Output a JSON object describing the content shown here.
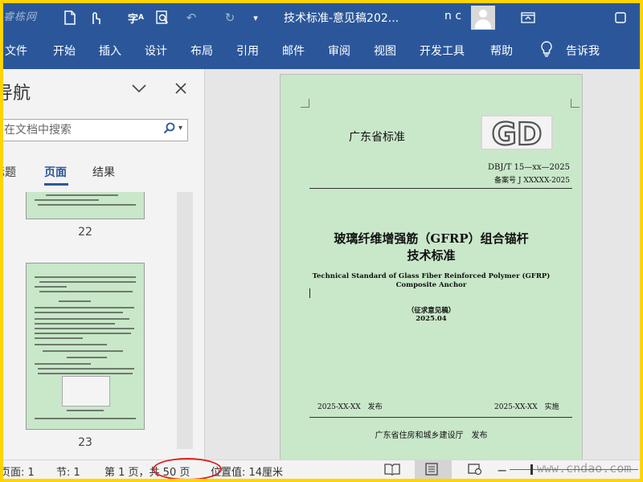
{
  "titlebar": {
    "watermark": "睿栋网",
    "title": "技术标准-意见稿202...",
    "user": "n c",
    "icons": [
      "new-doc-icon",
      "touch-mode-icon",
      "spelling-icon",
      "print-preview-icon",
      "undo-icon",
      "redo-icon",
      "customize-qat-icon",
      "ribbon-display-icon",
      "restore-window-icon"
    ]
  },
  "ribbon": {
    "tabs": [
      "文件",
      "开始",
      "插入",
      "设计",
      "布局",
      "引用",
      "邮件",
      "审阅",
      "视图",
      "开发工具",
      "帮助"
    ],
    "tell_me": "告诉我"
  },
  "nav": {
    "title": "导航",
    "search_placeholder": "在文档中搜索",
    "tabs": [
      "标题",
      "页面",
      "结果"
    ],
    "thumbnails": [
      {
        "page": "22"
      },
      {
        "page": "23"
      }
    ]
  },
  "page": {
    "standard_name": "广东省标准",
    "logo": "GD",
    "standard_number": "DBJ/T 15—xx—2025",
    "record_number": "备案号 J XXXXX-2025",
    "title_cn_1": "玻璃纤维增强筋（GFRP）组合锚杆",
    "title_cn_2": "技术标准",
    "title_en_1": "Technical Standard of Glass Fiber Reinforced Polymer (GFRP)",
    "title_en_2": "Composite Anchor",
    "draft_label": "（征求意见稿）",
    "draft_date": "2025.04",
    "publish_date": "2025-XX-XX　发布",
    "implement_date": "2025-XX-XX　实施",
    "issuer": "广东省住房和城乡建设厅　发布"
  },
  "status": {
    "page": "页面: 1",
    "section": "节: 1",
    "page_of": "第 1 页，共 50 页",
    "position": "位置值: 14厘米",
    "watermark": "www.cndao.com"
  },
  "colors": {
    "accent": "#2b579a",
    "page_bg": "#c9e7c9",
    "highlight_circle": "#e02020",
    "frame": "#ffd400"
  }
}
